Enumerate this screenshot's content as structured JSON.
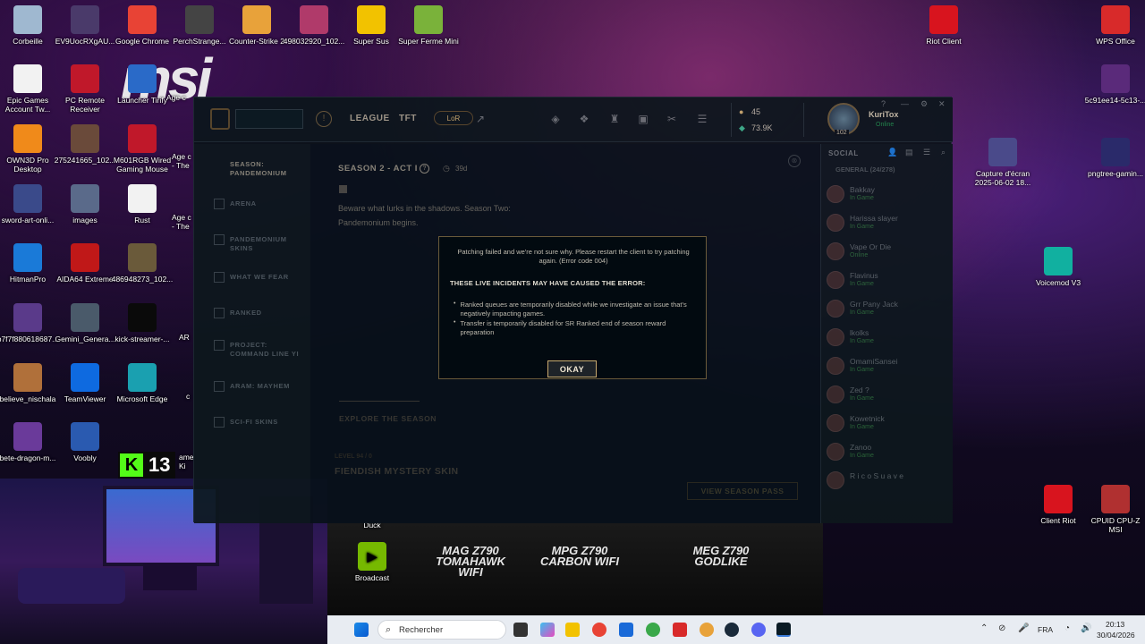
{
  "desktop": {
    "icons_left": [
      {
        "label": "Corbeille",
        "icon": "recycle-bin-icon",
        "color": "#9fb8d0"
      },
      {
        "label": "EV9UocRXgAU...",
        "icon": "image-icon",
        "color": "#4a3a6a"
      },
      {
        "label": "Google Chrome",
        "icon": "chrome-icon",
        "color": "#e84335"
      },
      {
        "label": "PerchStrange...",
        "icon": "image-icon",
        "color": "#444444"
      },
      {
        "label": "Counter-Strike 2",
        "icon": "cs2-icon",
        "color": "#e8a23a"
      },
      {
        "label": "498032920_102...",
        "icon": "image-icon",
        "color": "#b03a6a"
      },
      {
        "label": "Super Sus",
        "icon": "super-sus-icon",
        "color": "#f2c200"
      },
      {
        "label": "Super Ferme Mini",
        "icon": "super-ferme-icon",
        "color": "#7ab23a"
      },
      {
        "label": "Epic Games Account Tw...",
        "icon": "file-icon",
        "color": "#f2f2f2"
      },
      {
        "label": "PC Remote Receiver",
        "icon": "msi-dragon-icon",
        "color": "#c0182a"
      },
      {
        "label": "Launcher Tirify",
        "icon": "launcher-icon",
        "color": "#2a6ac8"
      },
      {
        "label": "OWN3D Pro Desktop",
        "icon": "own3d-icon",
        "color": "#f08a1a"
      },
      {
        "label": "275241665_102...",
        "icon": "image-icon",
        "color": "#6a4a3a"
      },
      {
        "label": "M601RGB Wired Gaming Mouse",
        "icon": "msi-dragon-icon",
        "color": "#c0182a"
      },
      {
        "label": "sword-art-onli...",
        "icon": "image-icon",
        "color": "#3a4a8a"
      },
      {
        "label": "images",
        "icon": "image-icon",
        "color": "#5a6a8a"
      },
      {
        "label": "Rust",
        "icon": "file-icon",
        "color": "#f2f2f2"
      },
      {
        "label": "HitmanPro",
        "icon": "hitmanpro-icon",
        "color": "#1a7ad8"
      },
      {
        "label": "AIDA64 Extreme",
        "icon": "aida64-icon",
        "color": "#c01818"
      },
      {
        "label": "486948273_102...",
        "icon": "image-icon",
        "color": "#6a5a3a"
      },
      {
        "label": "b7f7f880618687...",
        "icon": "image-icon",
        "color": "#5a3a8a"
      },
      {
        "label": "Gemini_Genera...",
        "icon": "image-icon",
        "color": "#4a5a6a"
      },
      {
        "label": "kick-streamer-...",
        "icon": "image-icon",
        "color": "#0a0a0a"
      },
      {
        "label": "believe_nischala",
        "icon": "image-icon",
        "color": "#b0703a"
      },
      {
        "label": "TeamViewer",
        "icon": "teamviewer-icon",
        "color": "#0e6ae0"
      },
      {
        "label": "Microsoft Edge",
        "icon": "edge-icon",
        "color": "#1aa0b0"
      },
      {
        "label": "bete-dragon-m...",
        "icon": "image-icon",
        "color": "#6a3a9a"
      },
      {
        "label": "Voobly",
        "icon": "voobly-icon",
        "color": "#2a5ab0"
      }
    ],
    "partial_labels": [
      "Age c",
      "Age c - The",
      "Age c - The",
      "AR",
      "c",
      "ame Ki"
    ],
    "icons_right": [
      {
        "label": "Riot Client",
        "icon": "riot-icon",
        "color": "#d8141e"
      },
      {
        "label": "WPS Office",
        "icon": "wps-icon",
        "color": "#d82a2a"
      },
      {
        "label": "5c91ee14-5c13-...",
        "icon": "image-icon",
        "color": "#5a2a7a"
      },
      {
        "label": "Capture d'écran 2025-06-02 18...",
        "icon": "image-icon",
        "color": "#4a4a8a"
      },
      {
        "label": "pngtree-gamin...",
        "icon": "image-icon",
        "color": "#2a2a6a"
      },
      {
        "label": "Voicemod V3",
        "icon": "voicemod-icon",
        "color": "#11b0a0"
      },
      {
        "label": "Client Riot",
        "icon": "riot-icon",
        "color": "#d8141e"
      },
      {
        "label": "CPUID CPU-Z MSI",
        "icon": "cpuz-icon",
        "color": "#b03030"
      }
    ],
    "kick_badge": "13",
    "broadcast": {
      "duck": "Duck",
      "label": "Broadcast"
    },
    "motherboards": [
      "MAG Z790 TOMAHAWK WIFI",
      "MPG Z790 CARBON WIFI",
      "MEG Z790 GODLIKE"
    ],
    "msi_logo": "msi"
  },
  "client": {
    "nav": {
      "league": "LEAGUE",
      "tft": "TFT",
      "lor": "LoR"
    },
    "currency": {
      "be": "45",
      "rp": "73.9K"
    },
    "profile": {
      "name": "KuriTox",
      "status": "Online",
      "level": "102"
    },
    "sidebar": [
      {
        "label": "SEASON: PANDEMONIUM",
        "active": true
      },
      {
        "label": "ARENA",
        "active": false
      },
      {
        "label": "PANDEMONIUM SKINS",
        "active": false
      },
      {
        "label": "WHAT WE FEAR",
        "active": false
      },
      {
        "label": "RANKED",
        "active": false
      },
      {
        "label": "PROJECT: COMMAND LINE YI",
        "active": false
      },
      {
        "label": "ARAM: MAYHEM",
        "active": false
      },
      {
        "label": "SCI-FI SKINS",
        "active": false
      }
    ],
    "main": {
      "season_title": "SEASON 2 - ACT I",
      "days": "39d",
      "tagline": "Beware what lurks in the shadows. Season Two: Pandemonium begins.",
      "explore": "EXPLORE THE SEASON",
      "level": "LEVEL 94 / 0",
      "reward": "FIENDISH MYSTERY SKIN",
      "pass_button": "VIEW SEASON PASS"
    },
    "social": {
      "header": "SOCIAL",
      "group": "GENERAL (24/278)",
      "friends": [
        {
          "name": "Bakkay",
          "status": "In Game"
        },
        {
          "name": "Harissa slayer",
          "status": "In Game"
        },
        {
          "name": "Vape Or Die",
          "status": "Online"
        },
        {
          "name": "Flavinus",
          "status": "In Game"
        },
        {
          "name": "Grr Pany Jack",
          "status": "In Game"
        },
        {
          "name": "lkolks",
          "status": "In Game"
        },
        {
          "name": "OmamiSansei",
          "status": "In Game"
        },
        {
          "name": "Zed ?",
          "status": "In Game"
        },
        {
          "name": "Kowetnick",
          "status": "In Game"
        },
        {
          "name": "Zanoo",
          "status": "In Game"
        },
        {
          "name": "R i c o S u a v e",
          "status": ""
        }
      ]
    }
  },
  "dialog": {
    "message": "Patching failed and we're not sure why. Please restart the client to try patching again. (Error code 004)",
    "incidents_title": "THESE LIVE INCIDENTS MAY HAVE CAUSED THE ERROR:",
    "incidents": [
      "Ranked queues are temporarily disabled while we investigate an issue that's negatively impacting games.",
      "Transfer is temporarily disabled for SR Ranked end of season reward preparation"
    ],
    "okay": "OKAY"
  },
  "taskbar": {
    "search_placeholder": "Rechercher",
    "language": "FRA",
    "time": "20:13",
    "date": "30/04/2026"
  }
}
